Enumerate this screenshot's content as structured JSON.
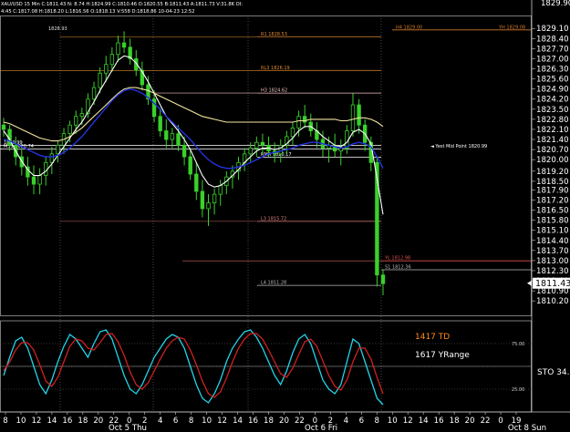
{
  "chart_data": {
    "type": "line",
    "header": {
      "line1": "XAU/USD 15 Min  C:1811.43  N: 8.74  H:1824.99  C:1810.46  O:1820.55  B:1811.43  A:1811.73  V:31.8K  OI:",
      "line2": "4:45  C:1817.08  H:1818.20  L:1816.56  O:1818.13  V:558  D:1818.86  10-04-23  12:52"
    },
    "price_axis": {
      "ylim": [
        1809.2,
        1830.0
      ],
      "ticks": [
        "1829.10",
        "1828.40",
        "1827.70",
        "1827.00",
        "1826.30",
        "1825.60",
        "1824.90",
        "1824.20",
        "1823.50",
        "1822.80",
        "1822.10",
        "1821.40",
        "1820.70",
        "1820.00",
        "1819.20",
        "1818.50",
        "1817.90",
        "1817.20",
        "1816.50",
        "1815.80",
        "1815.10",
        "1814.40",
        "1813.70",
        "1813.00",
        "1812.30",
        "1811.60",
        "1810.90",
        "1810.20"
      ],
      "last_price": "1811.43",
      "partial_top_label": "1829.90"
    },
    "levels": [
      {
        "label": "H4 1829.00",
        "right_label": "YH 1829.08",
        "value": 1829.0,
        "color": "#d07a2a"
      },
      {
        "label": "R1 1828.53",
        "value": 1828.53,
        "color": "#e08a30"
      },
      {
        "label": "RL3 1826.19",
        "value": 1826.19,
        "color": "#e08a30"
      },
      {
        "label": "H3 1824.62",
        "value": 1824.62,
        "color": "#f0c0c0"
      },
      {
        "label": "M51 1820.74",
        "value": 1820.74,
        "color": "#ffffff"
      },
      {
        "label": "RMR 1820.17",
        "value": 1820.17,
        "color": "#ffffff"
      },
      {
        "label": "L3 1815.72",
        "value": 1815.72,
        "color": "#e08080"
      },
      {
        "label": "S1 1812.36",
        "value": 1812.36,
        "color": "#bbbbbb"
      },
      {
        "label": "L4 1811.28",
        "value": 1811.28,
        "color": "#bbbbbb"
      },
      {
        "label": "YL 1812.98",
        "value": 1812.98,
        "color": "#e05050"
      },
      {
        "label": "1820.99",
        "value": 1820.99,
        "color": "#ffffff"
      }
    ],
    "mid_point_label": "◄ Yest Mid Point 1820.99",
    "prev_day_high_label": "1828.93",
    "series": [
      {
        "name": "price",
        "type": "candles",
        "color_up": "#39d12a",
        "color_down": "#39d12a",
        "ohlc": [
          [
            1822.4,
            1822.9,
            1821.6,
            1822.1
          ],
          [
            1822.1,
            1822.4,
            1820.6,
            1821.0
          ],
          [
            1821.0,
            1821.6,
            1819.6,
            1820.2
          ],
          [
            1820.2,
            1820.8,
            1818.9,
            1819.5
          ],
          [
            1819.5,
            1820.2,
            1818.2,
            1818.8
          ],
          [
            1818.8,
            1819.6,
            1817.6,
            1818.3
          ],
          [
            1818.3,
            1819.4,
            1817.6,
            1818.9
          ],
          [
            1818.9,
            1820.2,
            1818.2,
            1819.8
          ],
          [
            1819.8,
            1820.9,
            1819.0,
            1820.4
          ],
          [
            1820.4,
            1821.3,
            1819.8,
            1821.0
          ],
          [
            1821.0,
            1822.2,
            1820.4,
            1821.8
          ],
          [
            1821.8,
            1822.7,
            1821.2,
            1822.4
          ],
          [
            1822.4,
            1823.4,
            1821.8,
            1823.0
          ],
          [
            1823.0,
            1823.6,
            1822.4,
            1823.2
          ],
          [
            1823.2,
            1824.6,
            1822.9,
            1824.2
          ],
          [
            1824.2,
            1825.4,
            1823.8,
            1825.0
          ],
          [
            1825.0,
            1826.4,
            1824.6,
            1826.0
          ],
          [
            1826.0,
            1827.2,
            1825.4,
            1826.6
          ],
          [
            1826.6,
            1827.8,
            1826.1,
            1827.3
          ],
          [
            1827.3,
            1828.6,
            1826.8,
            1828.1
          ],
          [
            1828.1,
            1828.9,
            1827.4,
            1827.8
          ],
          [
            1827.8,
            1828.4,
            1826.6,
            1827.0
          ],
          [
            1827.0,
            1827.6,
            1825.8,
            1826.2
          ],
          [
            1826.2,
            1826.8,
            1824.8,
            1825.2
          ],
          [
            1825.2,
            1825.8,
            1823.8,
            1824.2
          ],
          [
            1824.2,
            1824.8,
            1822.6,
            1823.0
          ],
          [
            1823.0,
            1823.6,
            1821.6,
            1822.0
          ],
          [
            1822.0,
            1822.8,
            1820.8,
            1821.4
          ],
          [
            1821.4,
            1822.2,
            1820.8,
            1821.8
          ],
          [
            1821.8,
            1822.4,
            1820.6,
            1821.0
          ],
          [
            1821.0,
            1821.6,
            1819.6,
            1820.2
          ],
          [
            1820.2,
            1820.8,
            1818.6,
            1819.0
          ],
          [
            1819.0,
            1819.8,
            1817.2,
            1817.8
          ],
          [
            1817.8,
            1818.6,
            1816.0,
            1816.6
          ],
          [
            1816.6,
            1817.6,
            1815.4,
            1817.0
          ],
          [
            1817.0,
            1818.0,
            1816.2,
            1817.6
          ],
          [
            1817.6,
            1818.6,
            1816.8,
            1818.2
          ],
          [
            1818.2,
            1819.2,
            1817.6,
            1818.8
          ],
          [
            1818.8,
            1819.6,
            1818.0,
            1819.2
          ],
          [
            1819.2,
            1820.2,
            1818.6,
            1819.8
          ],
          [
            1819.8,
            1820.8,
            1819.2,
            1820.4
          ],
          [
            1820.4,
            1821.2,
            1819.8,
            1820.8
          ],
          [
            1820.8,
            1821.6,
            1820.2,
            1821.2
          ],
          [
            1821.2,
            1821.8,
            1820.4,
            1821.0
          ],
          [
            1821.0,
            1821.6,
            1820.2,
            1820.6
          ],
          [
            1820.6,
            1821.2,
            1819.8,
            1820.4
          ],
          [
            1820.4,
            1821.4,
            1819.8,
            1821.0
          ],
          [
            1821.0,
            1822.0,
            1820.4,
            1821.6
          ],
          [
            1821.6,
            1822.6,
            1821.0,
            1822.2
          ],
          [
            1822.2,
            1823.4,
            1821.6,
            1823.0
          ],
          [
            1823.0,
            1823.8,
            1822.2,
            1822.6
          ],
          [
            1822.6,
            1823.2,
            1821.6,
            1822.0
          ],
          [
            1822.0,
            1822.6,
            1820.8,
            1821.4
          ],
          [
            1821.4,
            1822.0,
            1820.2,
            1820.8
          ],
          [
            1820.8,
            1821.6,
            1819.8,
            1821.0
          ],
          [
            1821.0,
            1821.8,
            1820.2,
            1820.6
          ],
          [
            1820.6,
            1821.4,
            1819.6,
            1820.8
          ],
          [
            1820.8,
            1822.4,
            1820.4,
            1822.0
          ],
          [
            1822.0,
            1824.6,
            1821.6,
            1823.8
          ],
          [
            1823.8,
            1824.2,
            1821.8,
            1822.4
          ],
          [
            1822.4,
            1822.8,
            1820.6,
            1821.2
          ],
          [
            1821.2,
            1821.6,
            1819.2,
            1819.8
          ],
          [
            1819.8,
            1820.2,
            1811.2,
            1812.0
          ],
          [
            1812.0,
            1812.4,
            1810.6,
            1811.4
          ]
        ]
      },
      {
        "name": "ma-fast",
        "color": "#ffffff",
        "values": [
          1822.0,
          1821.4,
          1820.6,
          1819.9,
          1819.3,
          1818.9,
          1818.9,
          1819.2,
          1819.7,
          1820.3,
          1820.9,
          1821.5,
          1822.1,
          1822.6,
          1823.3,
          1824.0,
          1824.8,
          1825.5,
          1826.2,
          1826.9,
          1827.2,
          1827.1,
          1826.7,
          1826.1,
          1825.4,
          1824.6,
          1823.8,
          1823.0,
          1822.5,
          1822.0,
          1821.4,
          1820.7,
          1819.8,
          1818.9,
          1818.3,
          1818.1,
          1818.2,
          1818.5,
          1818.9,
          1819.3,
          1819.8,
          1820.2,
          1820.6,
          1820.8,
          1820.8,
          1820.7,
          1820.8,
          1821.1,
          1821.5,
          1822.0,
          1822.3,
          1822.3,
          1822.0,
          1821.6,
          1821.3,
          1821.0,
          1820.9,
          1821.2,
          1821.9,
          1822.1,
          1821.8,
          1821.1,
          1818.7,
          1816.2
        ]
      },
      {
        "name": "ma-slow",
        "color": "#f3e6a0",
        "values": [
          1822.6,
          1822.5,
          1822.3,
          1822.1,
          1821.9,
          1821.7,
          1821.5,
          1821.4,
          1821.3,
          1821.3,
          1821.4,
          1821.6,
          1821.9,
          1822.2,
          1822.6,
          1823.0,
          1823.4,
          1823.8,
          1824.2,
          1824.6,
          1824.9,
          1825.0,
          1825.0,
          1824.9,
          1824.8,
          1824.6,
          1824.4,
          1824.2,
          1824.0,
          1823.8,
          1823.6,
          1823.4,
          1823.2,
          1823.0,
          1822.9,
          1822.8,
          1822.7,
          1822.6,
          1822.6,
          1822.6,
          1822.6,
          1822.6,
          1822.6,
          1822.6,
          1822.6,
          1822.6,
          1822.6,
          1822.6,
          1822.6,
          1822.7,
          1822.7,
          1822.8,
          1822.8,
          1822.8,
          1822.8,
          1822.8,
          1822.7,
          1822.7,
          1822.8,
          1822.9,
          1822.9,
          1822.8,
          1822.6,
          1822.3
        ]
      },
      {
        "name": "ma-mid",
        "color": "#2233dd",
        "values": [
          1821.4,
          1821.3,
          1821.1,
          1820.9,
          1820.7,
          1820.5,
          1820.3,
          1820.2,
          1820.2,
          1820.3,
          1820.5,
          1820.8,
          1821.2,
          1821.6,
          1822.1,
          1822.6,
          1823.1,
          1823.6,
          1824.1,
          1824.5,
          1824.8,
          1824.9,
          1824.8,
          1824.6,
          1824.3,
          1823.9,
          1823.5,
          1823.0,
          1822.6,
          1822.2,
          1821.8,
          1821.4,
          1820.9,
          1820.4,
          1820.0,
          1819.7,
          1819.5,
          1819.4,
          1819.4,
          1819.5,
          1819.6,
          1819.8,
          1820.0,
          1820.2,
          1820.4,
          1820.5,
          1820.6,
          1820.7,
          1820.8,
          1821.0,
          1821.1,
          1821.2,
          1821.2,
          1821.1,
          1821.0,
          1820.9,
          1820.8,
          1820.9,
          1821.1,
          1821.2,
          1821.1,
          1820.9,
          1820.2,
          1819.4
        ]
      }
    ],
    "oscillator": {
      "name": "STO",
      "value_label": "STO 34.",
      "ticks": [
        "75.00",
        "25.00"
      ],
      "ylim": [
        0,
        100
      ],
      "td_label": "1417 TD",
      "yrange_label": "1617 YRange",
      "series": [
        {
          "name": "stoch-k",
          "color": "#22d4e8",
          "values": [
            40,
            60,
            78,
            82,
            70,
            50,
            30,
            20,
            35,
            55,
            72,
            85,
            80,
            70,
            60,
            75,
            88,
            90,
            80,
            60,
            40,
            25,
            20,
            30,
            45,
            60,
            70,
            80,
            85,
            82,
            70,
            50,
            30,
            15,
            10,
            20,
            35,
            55,
            70,
            80,
            88,
            90,
            82,
            70,
            55,
            40,
            30,
            45,
            65,
            80,
            85,
            75,
            55,
            35,
            25,
            20,
            30,
            55,
            80,
            75,
            55,
            35,
            15,
            8
          ]
        },
        {
          "name": "stoch-d",
          "color": "#d02020",
          "values": [
            45,
            55,
            68,
            76,
            76,
            68,
            52,
            34,
            28,
            38,
            55,
            72,
            80,
            78,
            70,
            68,
            76,
            85,
            86,
            77,
            62,
            44,
            30,
            25,
            32,
            45,
            58,
            70,
            78,
            82,
            80,
            68,
            52,
            34,
            20,
            16,
            22,
            37,
            55,
            70,
            80,
            86,
            86,
            80,
            68,
            55,
            42,
            38,
            48,
            63,
            77,
            80,
            72,
            56,
            40,
            28,
            24,
            35,
            55,
            70,
            70,
            58,
            38,
            20
          ]
        }
      ]
    },
    "x_axis": {
      "ticks": [
        "8",
        "10",
        "12",
        "14",
        "16",
        "18",
        "20",
        "22",
        "0",
        "2",
        "4",
        "6",
        "8",
        "10",
        "12",
        "14",
        "16",
        "18",
        "20",
        "22",
        "0",
        "2",
        "4",
        "6",
        "8",
        "10",
        "12",
        "14",
        "16",
        "18",
        "20",
        "22",
        "0",
        "19"
      ],
      "day_labels": [
        "Oct 5 Thu",
        "Oct 6 Fri",
        "Oct 8 Sun"
      ]
    }
  }
}
